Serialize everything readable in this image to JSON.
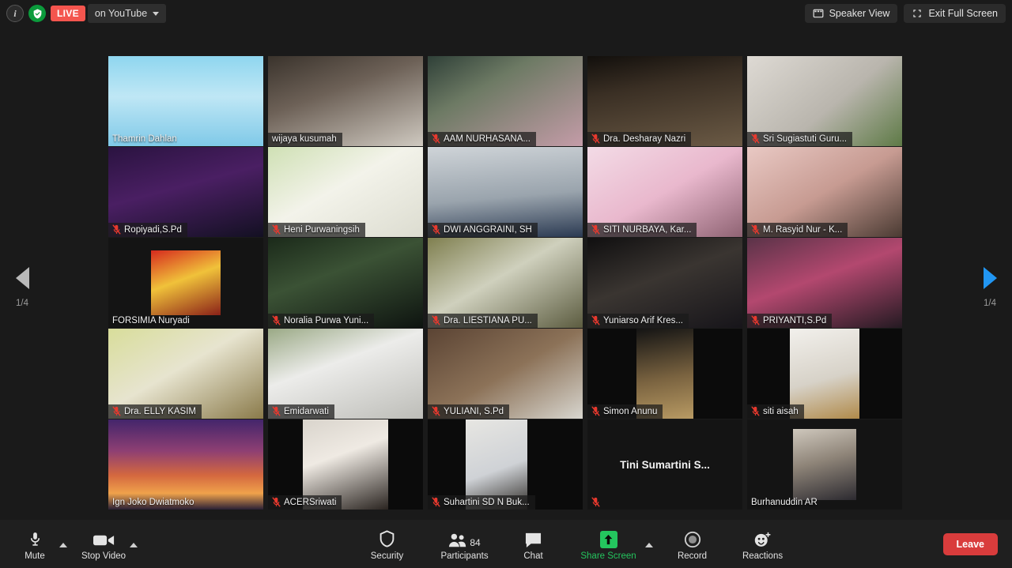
{
  "topbar": {
    "info_icon": "info-icon",
    "shield_icon": "shield-icon",
    "live_label": "LIVE",
    "stream_label": "on YouTube",
    "speaker_view_label": "Speaker View",
    "exit_full_screen_label": "Exit Full Screen"
  },
  "pager": {
    "left_label": "1/4",
    "right_label": "1/4"
  },
  "gallery": {
    "rows": [
      [
        {
          "name": "Thamrin Dahlan",
          "muted": false,
          "speaking": true,
          "bg": "slide-banner",
          "label_style": "plain"
        },
        {
          "name": "wijaya kusumah",
          "muted": false,
          "speaking": false,
          "bg": "man-white-cap",
          "label_style": "bar"
        },
        {
          "name": "AAM NURHASANA...",
          "muted": true,
          "speaking": false,
          "bg": "woman-pink-hijab",
          "label_style": "bar"
        },
        {
          "name": "Dra. Desharay Nazri",
          "muted": true,
          "speaking": false,
          "bg": "dark-room-person",
          "label_style": "bar"
        },
        {
          "name": "Sri Sugiastuti Guru...",
          "muted": true,
          "speaking": false,
          "bg": "woman-green-hijab",
          "label_style": "bar"
        }
      ],
      [
        {
          "name": "Ropiyadi,S.Pd",
          "muted": true,
          "speaking": false,
          "bg": "purple-stage-slide",
          "label_style": "bar"
        },
        {
          "name": "Heni Purwaningsih",
          "muted": true,
          "speaking": false,
          "bg": "ceiling-light",
          "label_style": "bar"
        },
        {
          "name": "DWI ANGGRAINI, SH",
          "muted": true,
          "speaking": false,
          "bg": "woman-blue-hijab",
          "label_style": "bar"
        },
        {
          "name": "SITI NURBAYA, Kar...",
          "muted": true,
          "speaking": false,
          "bg": "pink-curtain-room",
          "label_style": "bar"
        },
        {
          "name": "M. Rasyid Nur - K...",
          "muted": true,
          "speaking": false,
          "bg": "man-glasses-pink-wall",
          "label_style": "bar"
        }
      ],
      [
        {
          "name": "FORSIMIA Nuryadi",
          "muted": false,
          "speaking": false,
          "bg": "avatar-red-tent",
          "label_style": "plain"
        },
        {
          "name": "Noralia Purwa Yuni...",
          "muted": true,
          "speaking": false,
          "bg": "woman-dark-hijab-green",
          "label_style": "bar"
        },
        {
          "name": "Dra. LIESTIANA PU...",
          "muted": true,
          "speaking": false,
          "bg": "classroom-shelves",
          "label_style": "bar"
        },
        {
          "name": "Yuniarso Arif Kres...",
          "muted": true,
          "speaking": false,
          "bg": "man-dark-wall-art",
          "label_style": "bar"
        },
        {
          "name": "PRIYANTI,S.Pd",
          "muted": true,
          "speaking": false,
          "bg": "woman-magenta-hijab",
          "label_style": "bar"
        }
      ],
      [
        {
          "name": "Dra. ELLY KASIM",
          "muted": true,
          "speaking": false,
          "bg": "woman-yellow-hijab-curtain",
          "label_style": "bar"
        },
        {
          "name": "Emidarwati",
          "muted": true,
          "speaking": false,
          "bg": "woman-white-wall",
          "label_style": "bar"
        },
        {
          "name": "YULIANI, S.Pd",
          "muted": true,
          "speaking": false,
          "bg": "woman-white-hijab-wardrobe",
          "label_style": "bar"
        },
        {
          "name": "Simon Anunu",
          "muted": true,
          "speaking": false,
          "bg": "man-khaki-dark",
          "label_style": "bar"
        },
        {
          "name": "siti aisah",
          "muted": true,
          "speaking": false,
          "bg": "woman-white-room",
          "label_style": "bar"
        }
      ],
      [
        {
          "name": "Ign Joko Dwiatmoko",
          "muted": false,
          "speaking": false,
          "bg": "sydney-harbour-vbg",
          "label_style": "plain"
        },
        {
          "name": "ACERSriwati",
          "muted": true,
          "speaking": false,
          "bg": "woman-black-hijab-narrow",
          "label_style": "bar"
        },
        {
          "name": "Suhartini SD N Buk...",
          "muted": true,
          "speaking": false,
          "bg": "paper-held-narrow",
          "label_style": "bar"
        },
        {
          "name": "Tini Sumartini S...",
          "muted": true,
          "speaking": false,
          "bg": "name-only",
          "label_style": "center"
        },
        {
          "name": "Burhanuddin AR",
          "muted": false,
          "speaking": false,
          "bg": "avatar-man-suit",
          "label_style": "plain"
        }
      ]
    ]
  },
  "toolbar": {
    "mute_label": "Mute",
    "mute_icon": "microphone-icon",
    "stop_video_label": "Stop Video",
    "video_icon": "camera-icon",
    "security_label": "Security",
    "security_icon": "shield-icon",
    "participants_label": "Participants",
    "participants_icon": "people-icon",
    "participants_count": "84",
    "chat_label": "Chat",
    "chat_icon": "chat-bubble-icon",
    "share_screen_label": "Share Screen",
    "share_screen_icon": "share-arrow-up-icon",
    "record_label": "Record",
    "record_icon": "record-circle-icon",
    "reactions_label": "Reactions",
    "reactions_icon": "smiley-plus-icon",
    "leave_label": "Leave"
  },
  "colors": {
    "live_red": "#f4554e",
    "share_green": "#24c55e",
    "leave_red": "#d93c3c",
    "active_speaker": "#d4e81c",
    "pager_active": "#2196f3"
  }
}
